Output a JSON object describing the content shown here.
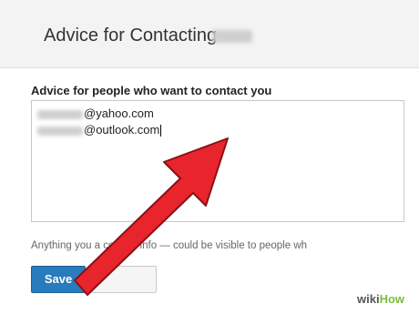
{
  "dialog": {
    "title": "Advice for Contacting",
    "field_label": "Advice for people who want to contact you",
    "textarea_lines": [
      "@yahoo.com",
      "@outlook.com"
    ],
    "hint": "Anything you a                         contact info — could be visible to people wh",
    "save_label": "Save",
    "cancel_label": ""
  },
  "overlay": {
    "arrow_color": "#e8242c",
    "watermark_prefix": "wiki",
    "watermark_suffix": "How"
  }
}
